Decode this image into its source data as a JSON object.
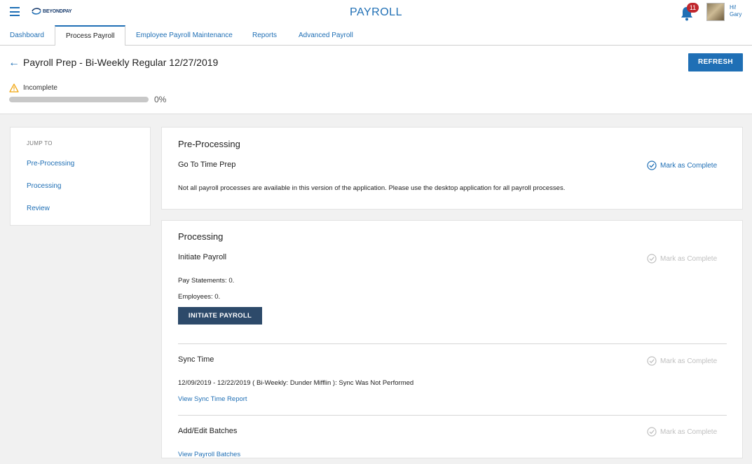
{
  "app": {
    "logo_text": "BEYONDPAY",
    "title": "PAYROLL",
    "notifications_count": "11",
    "greeting_hi": "Hi!",
    "greeting_name": "Gary"
  },
  "tabs": [
    {
      "label": "Dashboard",
      "active": false
    },
    {
      "label": "Process Payroll",
      "active": true
    },
    {
      "label": "Employee Payroll Maintenance",
      "active": false
    },
    {
      "label": "Reports",
      "active": false
    },
    {
      "label": "Advanced Payroll",
      "active": false
    }
  ],
  "header": {
    "title": "Payroll Prep - Bi-Weekly Regular 12/27/2019",
    "refresh_label": "REFRESH",
    "status": "Incomplete",
    "progress": 0,
    "progress_label": "0%"
  },
  "sidebar": {
    "heading": "JUMP TO",
    "items": [
      {
        "label": "Pre-Processing"
      },
      {
        "label": "Processing"
      },
      {
        "label": "Review"
      }
    ]
  },
  "pre_processing": {
    "title": "Pre-Processing",
    "step_title": "Go To Time Prep",
    "mark_label": "Mark as Complete",
    "message": "Not all payroll processes are available in this version of the application. Please use the desktop application for all payroll processes."
  },
  "processing": {
    "title": "Processing",
    "initiate": {
      "title": "Initiate Payroll",
      "mark_label": "Mark as Complete",
      "pay_statements": "Pay Statements: 0.",
      "employees": "Employees: 0.",
      "button_label": "INITIATE PAYROLL"
    },
    "sync": {
      "title": "Sync Time",
      "mark_label": "Mark as Complete",
      "detail": "12/09/2019 - 12/22/2019 ( Bi-Weekly: Dunder Mifflin ): Sync Was Not Performed",
      "link": "View Sync Time Report"
    },
    "batches": {
      "title": "Add/Edit Batches",
      "mark_label": "Mark as Complete",
      "link": "View Payroll Batches"
    }
  },
  "colors": {
    "accent": "#1f6fb5",
    "dark_button": "#2d4a6a",
    "badge": "#c0272d",
    "warning": "#f0a30a"
  }
}
